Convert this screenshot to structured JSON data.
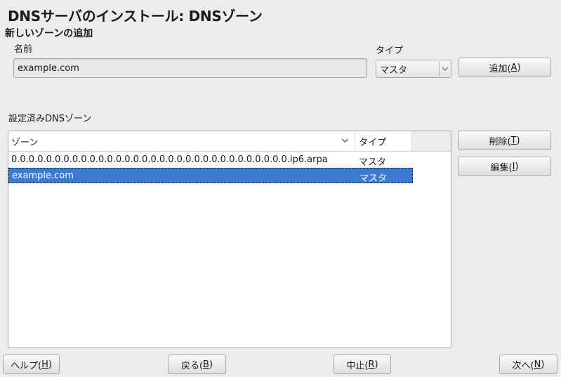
{
  "window": {
    "title": "DNSサーバのインストール: DNSゾーン"
  },
  "add_zone": {
    "section_title": "新しいゾーンの追加",
    "name_label": "名前",
    "name_value": "example.com",
    "type_label": "タイプ",
    "type_selected": "マスタ",
    "add_button": {
      "text": "追加(",
      "key": "A",
      "close": ")"
    }
  },
  "zones": {
    "label": "設定済みDNSゾーン",
    "columns": [
      "ゾーン",
      "タイプ"
    ],
    "rows": [
      {
        "zone": "0.0.0.0.0.0.0.0.0.0.0.0.0.0.0.0.0.0.0.0.0.0.0.0.0.0.0.0.0.0.0.0.ip6.arpa",
        "type": "マスタ",
        "selected": false
      },
      {
        "zone": "example.com",
        "type": "マスタ",
        "selected": true
      }
    ],
    "delete_button": {
      "text": "削除(",
      "key": "T",
      "close": ")"
    },
    "edit_button": {
      "text": "編集(",
      "key": "I",
      "close": ")"
    }
  },
  "footer": {
    "help": {
      "text": "ヘルプ(",
      "key": "H",
      "close": ")"
    },
    "back": {
      "text": "戻る(",
      "key": "B",
      "close": ")"
    },
    "abort": {
      "text": "中止(",
      "key": "R",
      "close": ")"
    },
    "next": {
      "text": "次へ(",
      "key": "N",
      "close": ")"
    }
  },
  "icons": {
    "chevron": "chevron-down-icon",
    "sort": "sort-chevron-icon"
  },
  "colors": {
    "selection": "#3b7bd6",
    "background": "#ececec"
  }
}
